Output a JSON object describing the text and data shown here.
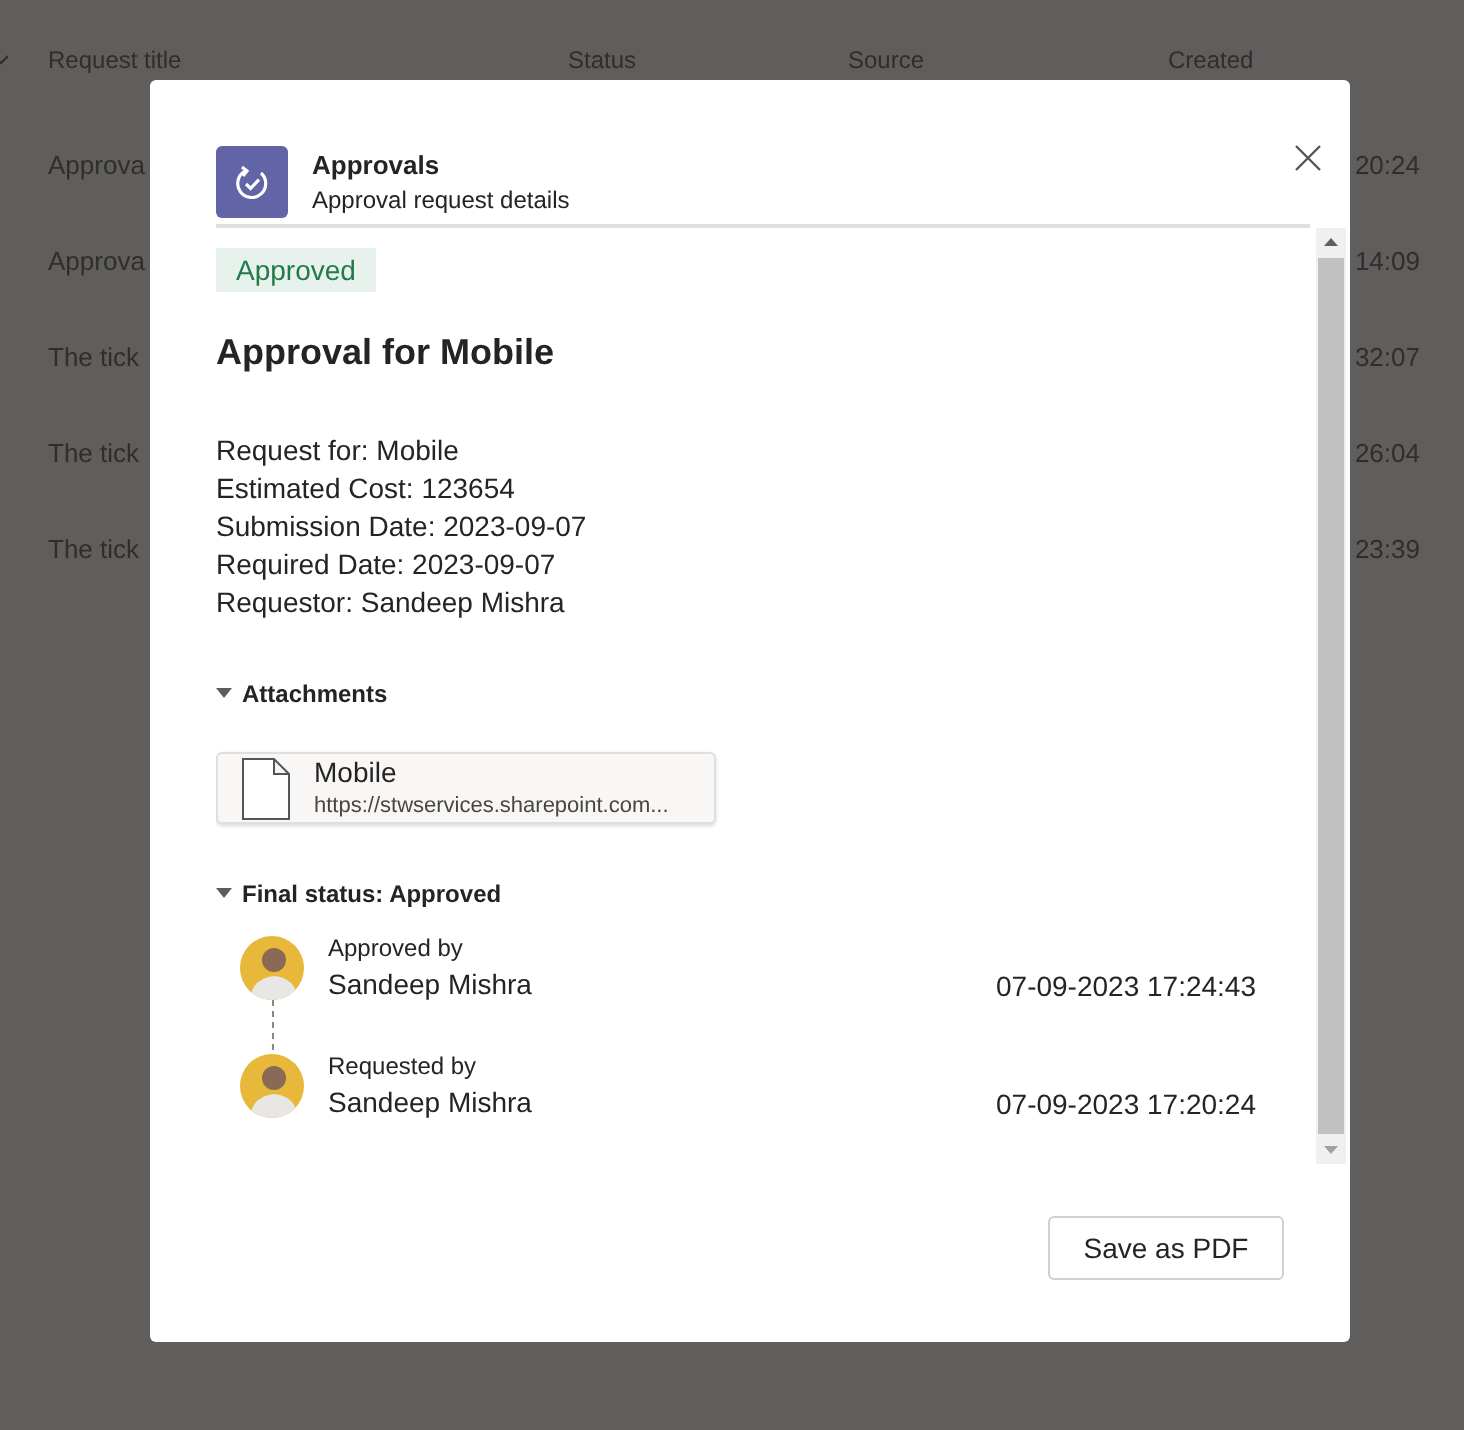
{
  "background_table": {
    "columns": [
      "Request title",
      "Status",
      "Source",
      "Created"
    ],
    "rows": [
      {
        "title": "Approva",
        "created": "20:24"
      },
      {
        "title": "Approva",
        "created": "14:09"
      },
      {
        "title": "The tick",
        "created": "32:07"
      },
      {
        "title": "The tick",
        "created": "26:04"
      },
      {
        "title": "The tick",
        "created": "23:39"
      }
    ]
  },
  "dialog": {
    "app_name": "Approvals",
    "subtitle": "Approval request details",
    "status_badge": {
      "label": "Approved",
      "kind": "approved"
    },
    "title": "Approval for Mobile",
    "details": [
      "Request for: Mobile",
      "Estimated Cost: 123654",
      "Submission Date: 2023-09-07",
      "Required Date: 2023-09-07",
      "Requestor: Sandeep Mishra"
    ],
    "attachments": {
      "heading": "Attachments",
      "expanded": true,
      "files": [
        {
          "name": "Mobile",
          "url": "https://stwservices.sharepoint.com..."
        }
      ]
    },
    "final_status": {
      "heading": "Final status: Approved",
      "expanded": true,
      "entries": [
        {
          "action": "Approved by",
          "person": "Sandeep Mishra",
          "time": "07-09-2023 17:24:43"
        },
        {
          "action": "Requested by",
          "person": "Sandeep Mishra",
          "time": "07-09-2023 17:20:24"
        }
      ]
    },
    "buttons": [
      "Save as PDF"
    ]
  }
}
